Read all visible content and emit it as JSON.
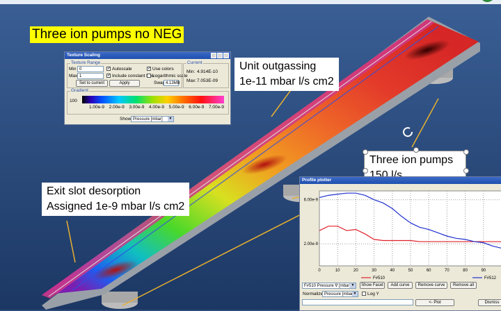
{
  "slide": {
    "title": "Three ion pumps no NEG",
    "callout_outgassing": [
      "Unit outgassing",
      "1e-11 mbar l/s cm2"
    ],
    "callout_exit": [
      "Exit slot desorption",
      "Assigned 1e-9 mbar l/s cm2"
    ],
    "callout_pumps": [
      "Three ion pumps",
      "150 l/s"
    ]
  },
  "texture_scaling": {
    "window_title": "Texture Scaling",
    "range_legend": "Texture Range",
    "min_label": "Min",
    "min_value": "0",
    "max_label": "Max",
    "max_value": "1",
    "autoscale_label": "Autoscale",
    "autoscale_checked": true,
    "use_colors_label": "Use colors",
    "use_colors_checked": true,
    "include_flow_label": "Include constant flow",
    "include_flow_checked": true,
    "log_scale_label": "Logarithmic scale",
    "log_scale_checked": false,
    "set_current_label": "Set to current",
    "apply_label": "Apply",
    "swap_label": "Swap",
    "swap_value": "4.13MB",
    "current_legend": "Current",
    "cur_min_label": "Min:",
    "cur_min_value": "4.914E-10",
    "cur_max_label": "Max:",
    "cur_max_value": "7.053E-09",
    "gradient_legend": "Gradient",
    "gradient_left": "100",
    "gradient_ticks": [
      "1.00e-9",
      "2.00e-9",
      "3.00e-9",
      "4.00e-9",
      "5.00e-9",
      "6.00e-9",
      "7.00e-9"
    ],
    "show_label": "Show",
    "show_value": "Pressure [mbar]"
  },
  "profile_plotter": {
    "window_title": "Profile plotter",
    "selector_value": "F#510 Pressure ∇ [mbar]",
    "show_facet_label": "Show Facet",
    "add_curve_label": "Add curve",
    "remove_curve_label": "Remove curve",
    "remove_all_label": "Remove all",
    "normalize_label": "Normalize",
    "normalize_value": "Pressure [mbar]",
    "log_y_label": "Log Y",
    "plot_label": "<- Plot",
    "dismiss_label": "Dismiss"
  },
  "chart_data": {
    "type": "line",
    "title": "",
    "xlabel": "",
    "ylabel": "",
    "xlim": [
      0,
      100
    ],
    "ylim": [
      0,
      6.8e-09
    ],
    "y_tick_labels": [
      {
        "value": 6e-09,
        "label": "6.00e-9"
      },
      {
        "value": 2e-09,
        "label": "2.00e-9"
      }
    ],
    "x_ticks": [
      0,
      10,
      20,
      30,
      40,
      50,
      60,
      70,
      80,
      90
    ],
    "grid": true,
    "legend": "bottom",
    "series": [
      {
        "name": "F#510",
        "color": "#e0202a",
        "x": [
          0,
          5,
          10,
          15,
          20,
          25,
          30,
          35,
          40,
          45,
          50,
          55,
          60,
          65,
          70,
          75,
          80,
          85,
          90,
          95,
          100
        ],
        "y": [
          3.2e-09,
          3.6e-09,
          3.6e-09,
          3.2e-09,
          3.3e-09,
          2.9e-09,
          2.4e-09,
          2.3e-09,
          2.3e-09,
          2.3e-09,
          2.3e-09,
          2.2e-09,
          2.2e-09,
          2.2e-09,
          2.2e-09,
          2.2e-09,
          2.2e-09,
          2.2e-09,
          2.2e-09,
          2.2e-09,
          2.2e-09
        ]
      },
      {
        "name": "F#512",
        "color": "#2030d0",
        "x": [
          0,
          5,
          10,
          15,
          20,
          25,
          30,
          35,
          40,
          45,
          50,
          55,
          60,
          65,
          70,
          75,
          80,
          85,
          90,
          95,
          100
        ],
        "y": [
          6.2e-09,
          6.4e-09,
          6.5e-09,
          6.6e-09,
          6.6e-09,
          6.4e-09,
          6e-09,
          5.7e-09,
          5.2e-09,
          4.5e-09,
          3.9e-09,
          3.5e-09,
          3.3e-09,
          3e-09,
          2.7e-09,
          2.5e-09,
          2.4e-09,
          2.2e-09,
          2.1e-09,
          1.8e-09,
          1.6e-09
        ]
      }
    ]
  }
}
